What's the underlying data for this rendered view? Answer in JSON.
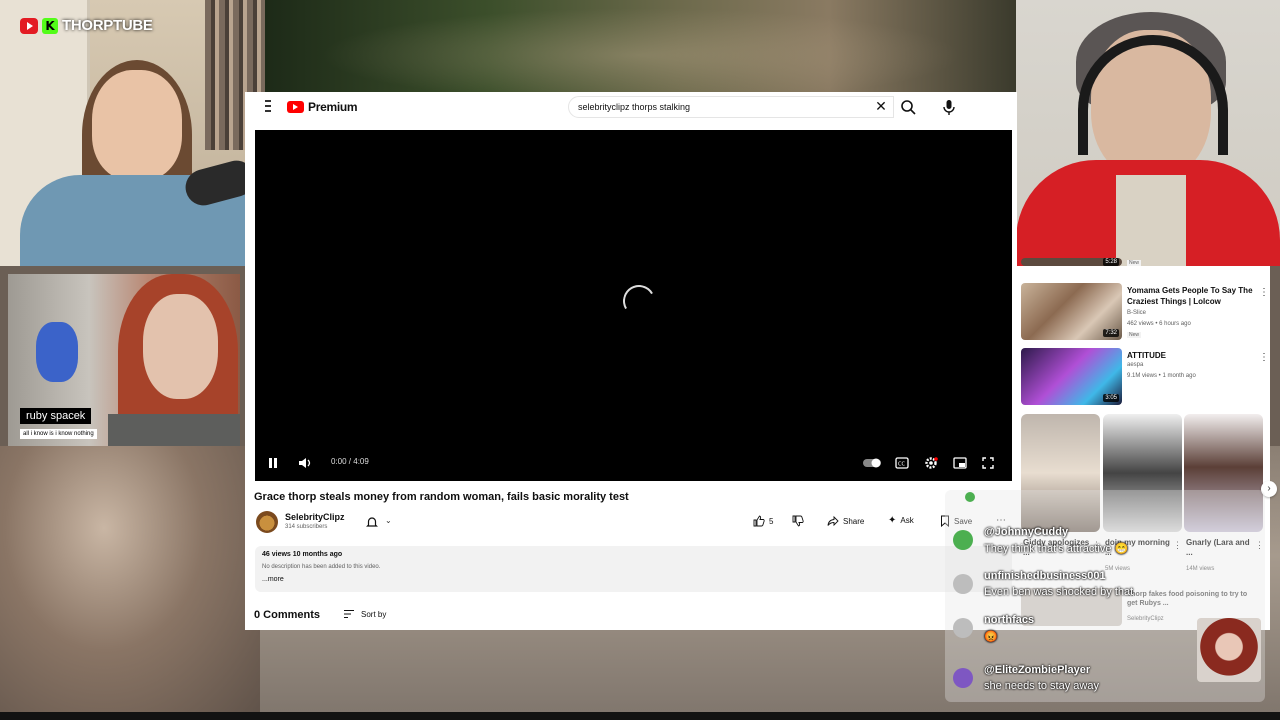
{
  "overlay": {
    "brand": "THORPTUBE",
    "clip_name_tag": "ruby spacek",
    "clip_subtag": "all i know is i know nothing"
  },
  "youtube": {
    "logo_text": "Premium",
    "search_value": "selebrityclipz thorps stalking",
    "player": {
      "time": "0:00 / 4:09"
    },
    "video_title": "Grace thorp steals money from random woman, fails basic morality test",
    "channel": {
      "name": "SelebrityClipz",
      "subscribers": "314 subscribers"
    },
    "actions": {
      "likes": "5",
      "share": "Share",
      "ask": "Ask",
      "save": "Save"
    },
    "description": {
      "meta": "46 views  10 months ago",
      "text": "No description has been added to this video.",
      "more": "...more"
    },
    "comments": {
      "count_label": "0 Comments",
      "sort_label": "Sort by"
    },
    "sidebar": {
      "partial_item": {
        "new": "New",
        "duration": "5:28"
      },
      "items": [
        {
          "title": "Yomama Gets People To Say The Craziest Things | Lolcow",
          "channel": "B-Slice",
          "meta": "462 views • 6 hours ago",
          "badge": "New",
          "duration": "7:32"
        },
        {
          "title": "ATTITUDE",
          "channel": "aespa",
          "meta": "9.1M views • 1 month ago",
          "duration": "3:05"
        }
      ],
      "shorts": [
        {
          "title": "Giddy apologizes ...",
          "views": ""
        },
        {
          "title": "doin my morning ...",
          "views": "5M views"
        },
        {
          "title": "Gnarly (Lara and ...",
          "views": "14M views"
        }
      ],
      "hidden_item": {
        "title": "Thorp fakes food poisoning to try to get Rubys ...",
        "channel": "SelebrityClipz"
      }
    }
  },
  "chat": {
    "messages": [
      {
        "user": "@JohnnyCuddy",
        "text": "They think that's attractive 😁",
        "color": "#4caf50"
      },
      {
        "user": "unfinishedbusiness001",
        "text": "Even ben was shocked by that",
        "color": "#bdbdbd"
      },
      {
        "user": "northfacs",
        "text": "😡",
        "color": "#bdbdbd"
      },
      {
        "user": "@EliteZombiePlayer",
        "text": "she needs to stay away",
        "color": "#7e57c2"
      }
    ]
  },
  "colors": {
    "youtube_red": "#ff0000",
    "kick_green": "#53fc18",
    "jacket_red": "#d61f25"
  }
}
